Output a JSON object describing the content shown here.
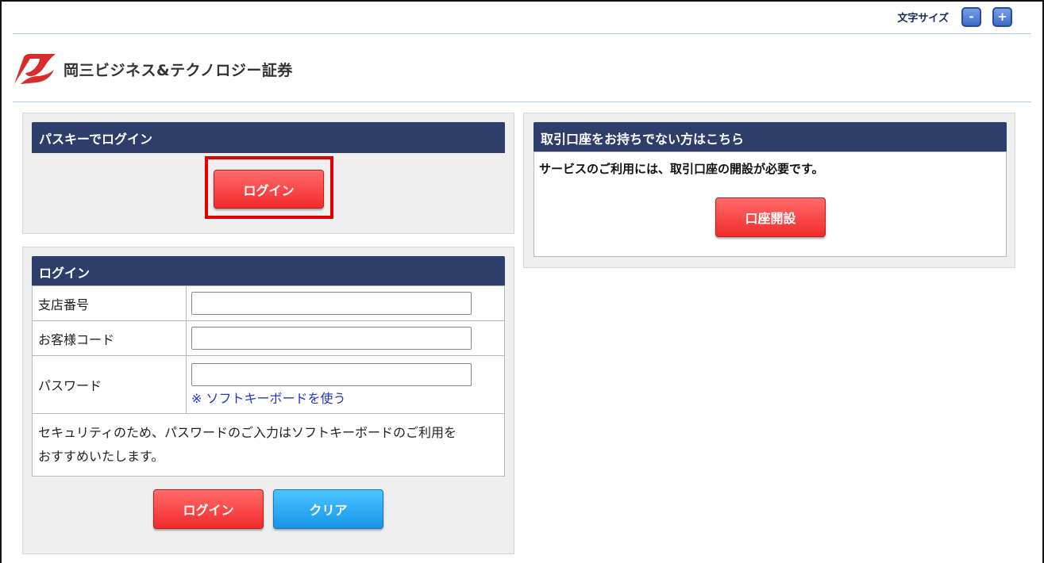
{
  "header": {
    "font_size_label": "文字サイズ",
    "font_minus": "-",
    "font_plus": "+",
    "logo_text": "岡三ビジネス&テクノロジー証券"
  },
  "passkey": {
    "title": "パスキーでログイン",
    "login_button": "ログイン"
  },
  "login": {
    "title": "ログイン",
    "branch_label": "支店番号",
    "branch_value": "",
    "customer_label": "お客様コード",
    "customer_value": "",
    "password_label": "パスワード",
    "password_value": "",
    "soft_keyboard_link": "※ ソフトキーボードを使う",
    "security_note_line1": "セキュリティのため、パスワードのご入力はソフトキーボードのご利用を",
    "security_note_line2": "おすすめいたします。",
    "login_button": "ログイン",
    "clear_button": "クリア"
  },
  "open_account": {
    "title": "取引口座をお持ちでない方はこちら",
    "message": "サービスのご利用には、取引口座の開設が必要です。",
    "button": "口座開設"
  },
  "colors": {
    "header_bar": "#2d3e6a",
    "red_button": "#f22a2a",
    "blue_button": "#1596ea",
    "highlight": "#e00000",
    "logo_red": "#d92b2b"
  }
}
